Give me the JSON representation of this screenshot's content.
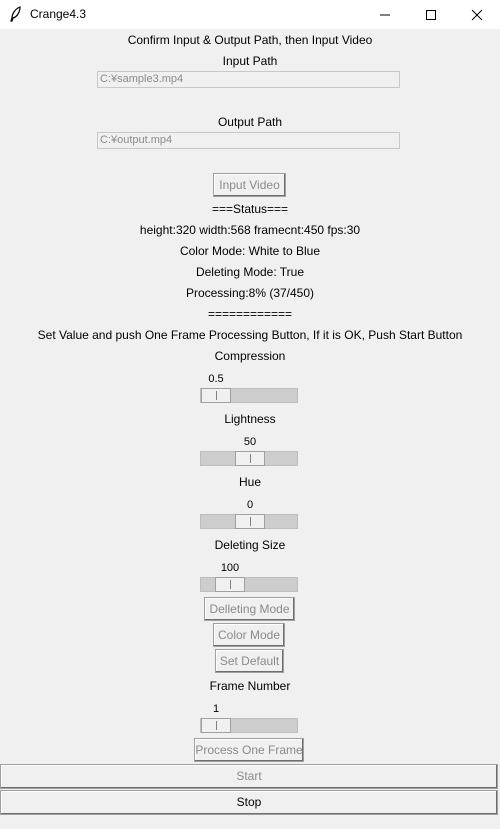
{
  "window": {
    "title": "Crange4.3"
  },
  "header": {
    "instruction": "Confirm Input & Output Path, then Input Video"
  },
  "input_path": {
    "label": "Input Path",
    "value": "C:¥sample3.mp4"
  },
  "output_path": {
    "label": "Output Path",
    "value": "C:¥output.mp4"
  },
  "input_video_button": "Input Video",
  "status": {
    "header": "===Status===",
    "video_info": "height:320 width:568 framecnt:450 fps:30",
    "color_mode": "Color Mode: White to Blue",
    "deleting_mode": "Deleting Mode: True",
    "processing": "Processing:8% (37/450)",
    "footer": "============"
  },
  "instruction2": "Set Value and push One Frame Processing Button, If it is OK, Push Start Button",
  "sliders": {
    "compression": {
      "label": "Compression",
      "value": "0.5",
      "fraction": 0.0
    },
    "lightness": {
      "label": "Lightness",
      "value": "50",
      "fraction": 0.5
    },
    "hue": {
      "label": "Hue",
      "value": "0",
      "fraction": 0.5
    },
    "deleting_size": {
      "label": "Deleting Size",
      "value": "100",
      "fraction": 0.2
    },
    "frame_number": {
      "label": "Frame Number",
      "value": "1",
      "fraction": 0.0
    }
  },
  "buttons": {
    "delleting_mode": "Delleting Mode",
    "color_mode": "Color Mode",
    "set_default": "Set Default",
    "process_one_frame": "Process One Frame",
    "start": "Start",
    "stop": "Stop"
  }
}
